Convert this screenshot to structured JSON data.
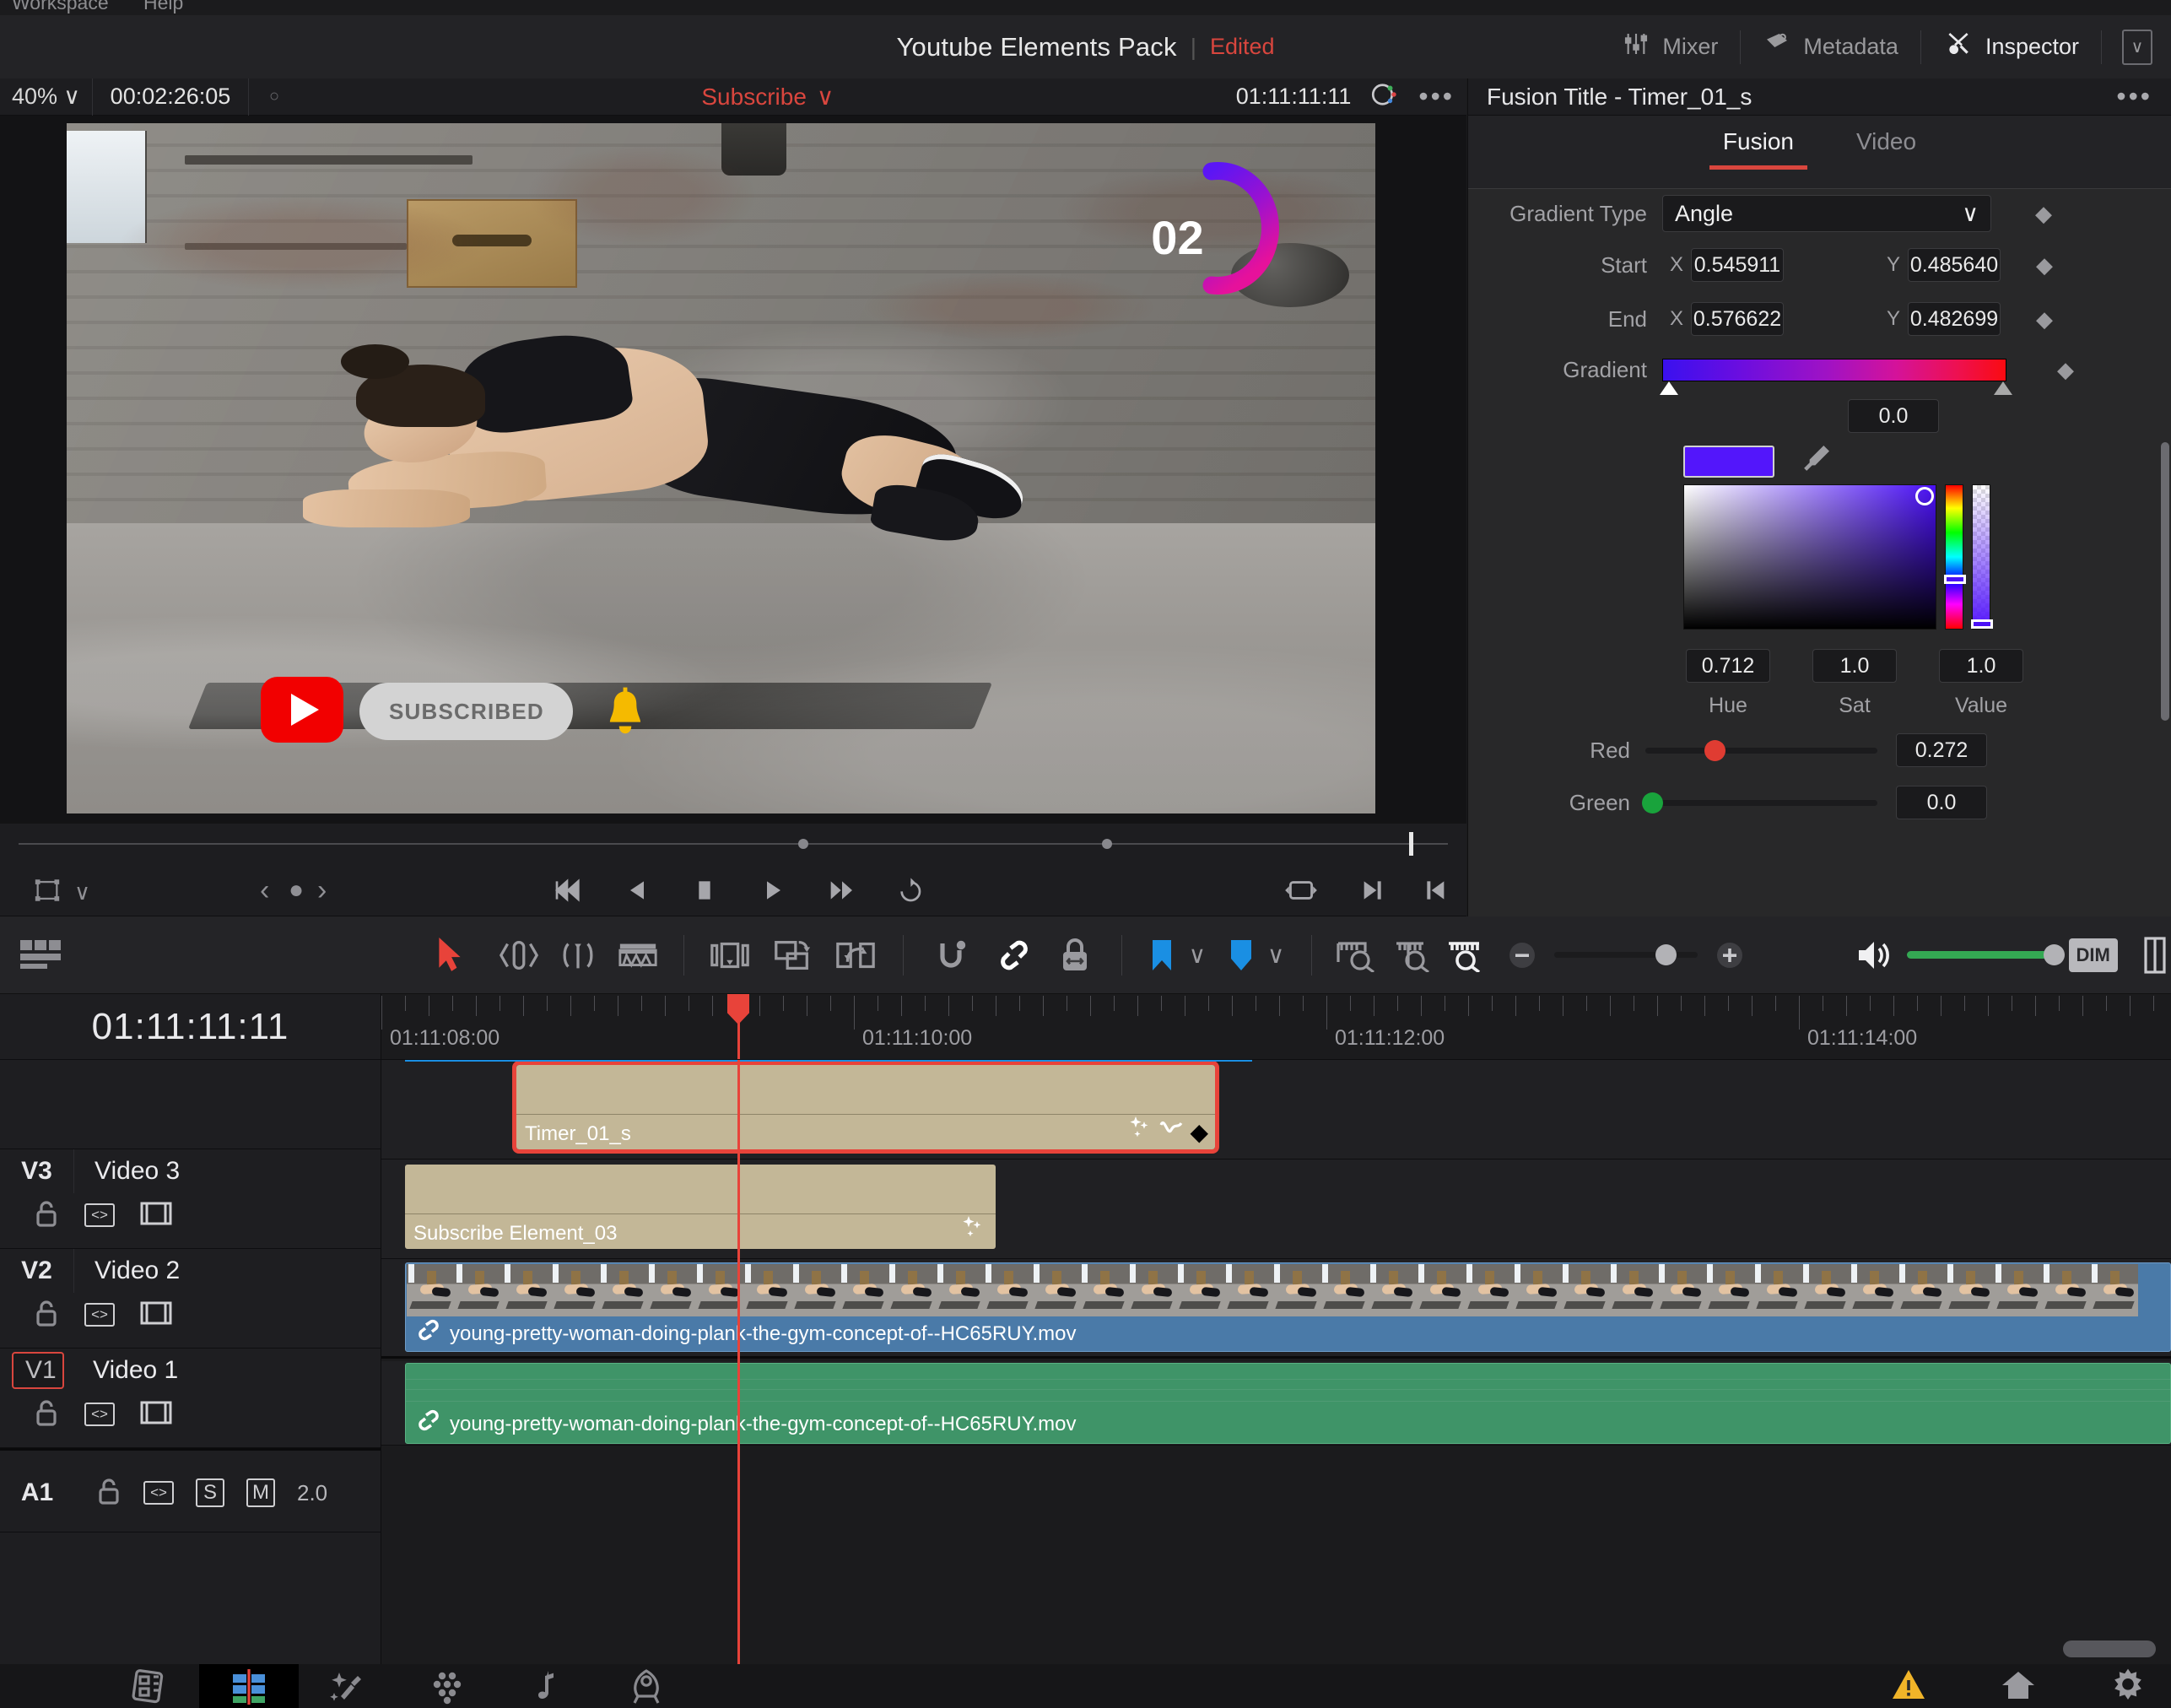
{
  "menubar": {
    "items": [
      "Workspace",
      "Help"
    ]
  },
  "titlebar": {
    "project_name": "Youtube Elements Pack",
    "separator": "|",
    "edited_label": "Edited",
    "buttons": [
      {
        "label": "Mixer",
        "icon": "mixer-icon"
      },
      {
        "label": "Metadata",
        "icon": "metadata-icon"
      },
      {
        "label": "Inspector",
        "icon": "inspector-icon"
      }
    ],
    "collapse_icon": "chevron-down-icon"
  },
  "viewer": {
    "zoom_level": "40%",
    "zoom_caret": "∨",
    "timecode_left": "00:02:26:05",
    "marker_dot": "○",
    "clip_name": "Subscribe",
    "clip_caret": "∨",
    "timecode_right": "01:11:11:11",
    "more_icon": "•••",
    "overlay": {
      "timer_number": "02",
      "subscribe_button_label": "SUBSCRIBED",
      "play_icon": "youtube-play-icon",
      "bell_icon": "notification-bell-icon"
    },
    "transport": {
      "frame_icon": "viewer-mode-icon",
      "frame_caret": "∨",
      "prev_marker": "‹",
      "marker_dot": "●",
      "next_marker": "›",
      "jump_start": "jump-to-start-icon",
      "play_reverse": "play-reverse-icon",
      "stop": "stop-icon",
      "play_forward": "play-forward-icon",
      "jump_end": "jump-to-end-icon",
      "loop": "loop-icon",
      "match_frame": "match-frame-icon",
      "in_point": "mark-out-icon",
      "out_point": "mark-in-icon"
    }
  },
  "inspector": {
    "header_title": "Fusion Title - Timer_01_s",
    "header_more": "•••",
    "tabs": [
      {
        "label": "Fusion",
        "active": true
      },
      {
        "label": "Video",
        "active": false
      }
    ],
    "params": {
      "gradient_type_label": "Gradient Type",
      "gradient_type_value": "Angle",
      "start_label": "Start",
      "start_x_label": "X",
      "start_x_value": "0.545911",
      "start_y_label": "Y",
      "start_y_value": "0.485640",
      "end_label": "End",
      "end_x_label": "X",
      "end_x_value": "0.576622",
      "end_y_label": "Y",
      "end_y_value": "0.482699",
      "gradient_label": "Gradient",
      "gradient_position_value": "0.0",
      "gradient_colors": [
        "#3a10ef",
        "#a012c4",
        "#fa0b11"
      ],
      "swatch_color": "#5316fb",
      "eyedropper_icon": "eyedropper-icon",
      "hue_value": "0.712",
      "hue_label": "Hue",
      "sat_value": "1.0",
      "sat_label": "Sat",
      "value_value": "1.0",
      "value_label": "Value",
      "red_label": "Red",
      "red_value": "0.272",
      "green_label": "Green",
      "green_value": "0.0",
      "keyframe_icon": "keyframe-diamond-icon"
    }
  },
  "timeline_toolbar": {
    "layout_icon": "timeline-layout-icon",
    "tools": [
      {
        "icon": "selection-arrow-icon",
        "active": true
      },
      {
        "icon": "trim-edit-icon",
        "active": false
      },
      {
        "icon": "dynamic-trim-icon",
        "active": false
      },
      {
        "icon": "razor-edit-icon",
        "active": false
      },
      {
        "icon": "insert-clip-icon",
        "active": false
      },
      {
        "icon": "overwrite-clip-icon",
        "active": false
      },
      {
        "icon": "replace-clip-icon",
        "active": false
      },
      {
        "icon": "snapping-magnet-icon",
        "active": false
      },
      {
        "icon": "link-clips-icon",
        "active": true
      },
      {
        "icon": "flag-lock-icon",
        "active": false
      },
      {
        "icon": "flag-icon",
        "active": false
      },
      {
        "icon": "marker-icon",
        "active": false
      },
      {
        "icon": "fit-timeline-icon",
        "active": false
      },
      {
        "icon": "detail-zoom-icon",
        "active": false
      },
      {
        "icon": "custom-zoom-icon",
        "active": true
      }
    ],
    "zoom_minus": "−",
    "zoom_plus": "+",
    "audio_icon": "speaker-icon",
    "dim_label": "DIM",
    "panel_icon": "split-panel-icon"
  },
  "timeline": {
    "playhead_timecode": "01:11:11:11",
    "ruler_labels": [
      "01:11:08:00",
      "01:11:10:00",
      "01:11:12:00",
      "01:11:14:00"
    ],
    "tracks": [
      {
        "id": "V3",
        "name": "Video 3",
        "selected": false,
        "type": "video",
        "buttons": [
          "lock-icon",
          "auto-select-icon",
          "video-enable-icon"
        ]
      },
      {
        "id": "V2",
        "name": "Video 2",
        "selected": false,
        "type": "video",
        "buttons": [
          "lock-icon",
          "auto-select-icon",
          "video-enable-icon"
        ]
      },
      {
        "id": "V1",
        "name": "Video 1",
        "selected": true,
        "type": "video",
        "buttons": [
          "lock-icon",
          "auto-select-icon",
          "video-enable-icon"
        ]
      },
      {
        "id": "A1",
        "name": "",
        "selected": false,
        "type": "audio",
        "buttons": [
          "lock-icon",
          "auto-select-icon"
        ],
        "solo_label": "S",
        "mute_label": "M",
        "channels": "2.0"
      }
    ],
    "clips": [
      {
        "track": "V3",
        "name": "Timer_01_s",
        "color": "#c3b797",
        "selected": true,
        "badges": [
          "fusion-sparkle-icon",
          "keyframe-curve-icon",
          "keyframe-diamond-icon"
        ]
      },
      {
        "track": "V2",
        "name": "Subscribe Element_03",
        "color": "#c3b797",
        "selected": false,
        "badges": [
          "fusion-sparkle-icon"
        ]
      },
      {
        "track": "V1",
        "name": "young-pretty-woman-doing-plank-the-gym-concept-of--HC65RUY.mov",
        "color": "#4a7aa8",
        "selected": false,
        "link_icon": "link-icon"
      },
      {
        "track": "A1",
        "name": "young-pretty-woman-doing-plank-the-gym-concept-of--HC65RUY.mov",
        "color": "#3f9468",
        "selected": false,
        "link_icon": "link-icon"
      }
    ]
  },
  "bottom_nav": {
    "pages": [
      {
        "icon": "media-page-icon",
        "active": false
      },
      {
        "icon": "edit-page-icon",
        "active": true
      },
      {
        "icon": "fusion-page-icon",
        "active": false
      },
      {
        "icon": "color-page-icon",
        "active": false
      },
      {
        "icon": "fairlight-page-icon",
        "active": false
      },
      {
        "icon": "deliver-page-icon",
        "active": false
      }
    ],
    "right_icons": [
      {
        "icon": "warning-icon",
        "color": "#f0b429"
      },
      {
        "icon": "home-icon",
        "color": "#9a9a9f"
      },
      {
        "icon": "settings-gear-icon",
        "color": "#9a9a9f"
      }
    ]
  },
  "colors": {
    "accent_red": "#d9463e",
    "selection_blue": "#1a8fe3",
    "gen_clip": "#c3b797",
    "video_clip": "#4a7aa8",
    "audio_clip": "#3f9468"
  }
}
